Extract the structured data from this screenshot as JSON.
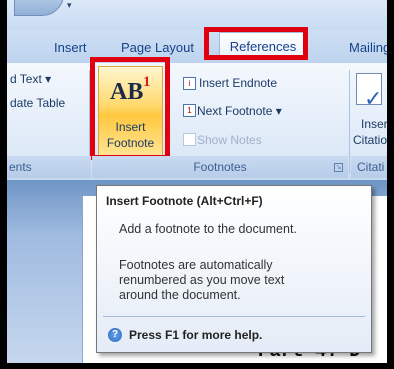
{
  "tabs": {
    "insert": "Insert",
    "page_layout": "Page Layout",
    "references": "References",
    "mailings": "Mailings"
  },
  "ribbon": {
    "left_group": {
      "cmd1": "d Text ▾",
      "cmd2": "date Table",
      "label": "ents"
    },
    "insert_footnote": {
      "glyph": "AB",
      "superscript": "1",
      "label_line1": "Insert",
      "label_line2": "Footnote"
    },
    "commands": {
      "insert_endnote": "Insert Endnote",
      "next_footnote": "Next Footnote ▾",
      "show_notes": "Show Notes"
    },
    "footnotes_group_label": "Footnotes",
    "citation": {
      "label_line1": "Insert",
      "label_line2": "Citation ▾",
      "group_label": "Citati"
    }
  },
  "tooltip": {
    "title": "Insert Footnote (Alt+Ctrl+F)",
    "description": "Add a footnote to the document.",
    "more_lines": [
      "Footnotes are automatically",
      "renumbered as you move text",
      "around the document."
    ],
    "help": "Press F1 for more help."
  },
  "document": {
    "visible_text": "Part 4: D"
  },
  "colors": {
    "highlight": "#e0000f",
    "ribbon_text": "#15428b",
    "active_button": "#ffc83f"
  },
  "icons": {
    "endnote": "insert-endnote-icon",
    "next_footnote": "next-footnote-icon",
    "show_notes": "show-notes-icon",
    "citation": "insert-citation-icon",
    "help": "help-icon"
  }
}
